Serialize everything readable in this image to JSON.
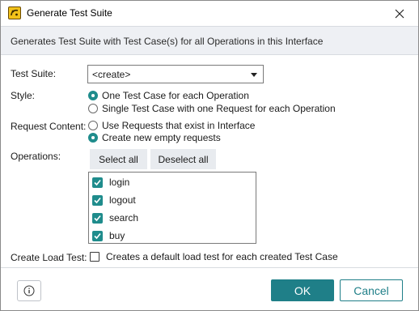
{
  "window": {
    "title": "Generate Test Suite",
    "app_icon": "soapui-icon",
    "close_icon": "close-icon"
  },
  "description": "Generates Test Suite with Test Case(s) for all Operations in this Interface",
  "form": {
    "test_suite": {
      "label": "Test Suite:",
      "selected": "<create>"
    },
    "style": {
      "label": "Style:",
      "options": [
        {
          "label": "One Test Case for each Operation",
          "selected": true
        },
        {
          "label": "Single Test Case with one Request for each Operation",
          "selected": false
        }
      ]
    },
    "request_content": {
      "label": "Request Content:",
      "options": [
        {
          "label": "Use Requests that exist in Interface",
          "selected": false
        },
        {
          "label": "Create new empty requests",
          "selected": true
        }
      ]
    },
    "operations": {
      "label": "Operations:",
      "select_all_label": "Select all",
      "deselect_all_label": "Deselect all",
      "items": [
        {
          "label": "login",
          "checked": true
        },
        {
          "label": "logout",
          "checked": true
        },
        {
          "label": "search",
          "checked": true
        },
        {
          "label": "buy",
          "checked": true
        }
      ]
    },
    "load_test": {
      "label": "Create Load Test:",
      "checkbox_label": "Creates a default load test for each created Test Case",
      "checked": false
    }
  },
  "footer": {
    "info_icon": "info-icon",
    "ok_label": "OK",
    "cancel_label": "Cancel"
  },
  "colors": {
    "accent": "#1f7f88",
    "description_band": "#eef0f4"
  }
}
